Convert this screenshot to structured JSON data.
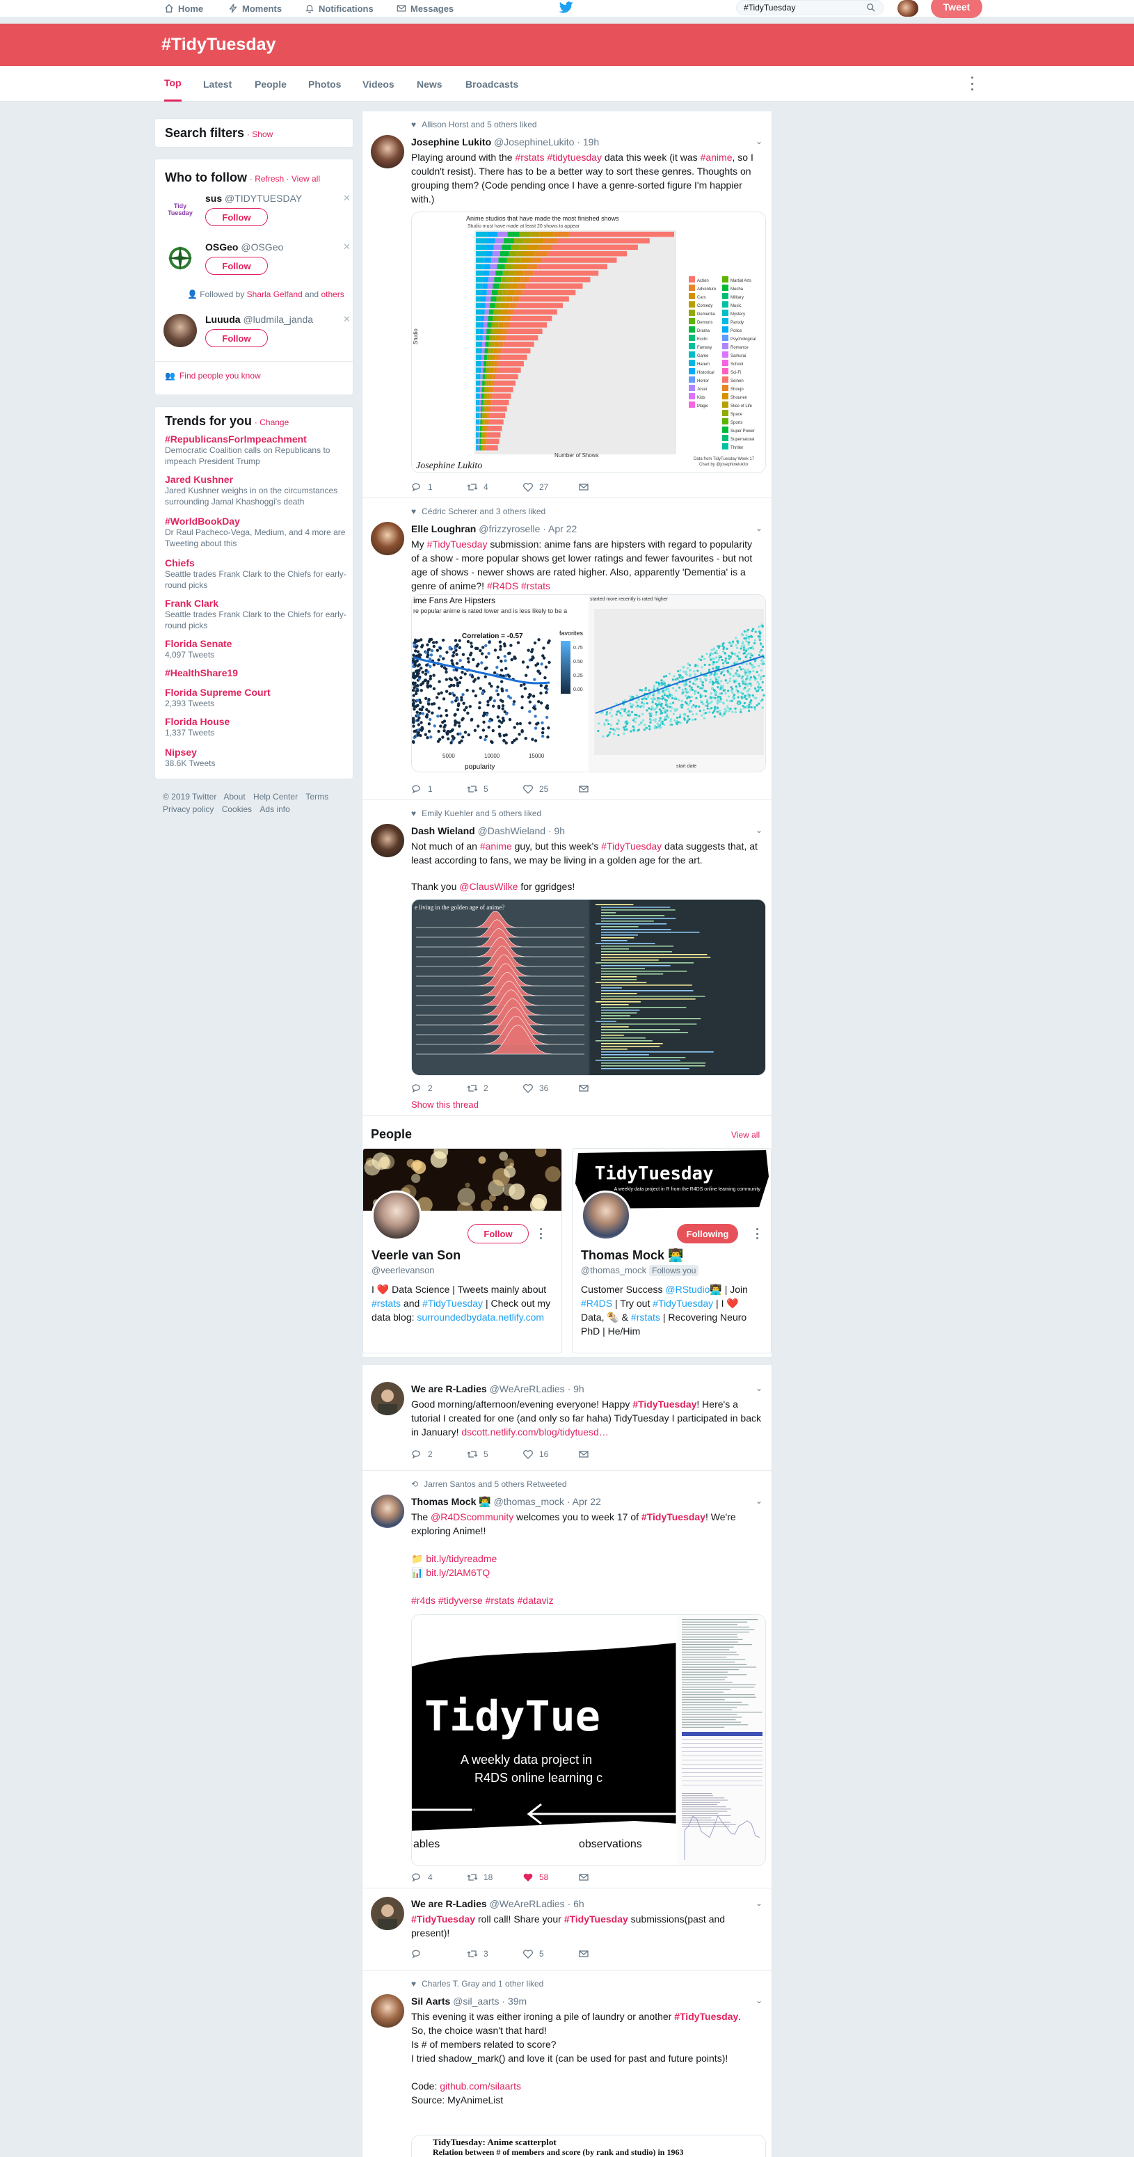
{
  "nav": {
    "home": "Home",
    "moments": "Moments",
    "notifications": "Notifications",
    "messages": "Messages",
    "search_value": "#TidyTuesday",
    "tweet": "Tweet"
  },
  "banner_title": "#TidyTuesday",
  "tabs": [
    "Top",
    "Latest",
    "People",
    "Photos",
    "Videos",
    "News",
    "Broadcasts"
  ],
  "search_filters": {
    "title": "Search filters",
    "show": "· Show"
  },
  "who_to_follow": {
    "title": "Who to follow",
    "refresh": "· Refresh · View all",
    "users": [
      {
        "name": "sus",
        "handle": "@TIDYTUESDAY",
        "follow": "Follow",
        "logo_text": "Tidy Tuesday"
      },
      {
        "name": "OSGeo",
        "handle": "@OSGeo",
        "follow": "Follow"
      },
      {
        "name": "Luuuda",
        "handle": "@ludmila_janda",
        "follow": "Follow"
      }
    ],
    "followed_by_prefix": "Followed by",
    "followed_by_name": "Sharla Gelfand",
    "followed_by_mid": "and",
    "followed_by_others": "others",
    "find_people": "Find people you know"
  },
  "trends": {
    "title": "Trends for you",
    "change": "· Change",
    "items": [
      {
        "name": "#RepublicansForImpeachment",
        "desc": "Democratic Coalition calls on Republicans to impeach President Trump"
      },
      {
        "name": "Jared Kushner",
        "desc": "Jared Kushner weighs in on the circumstances surrounding Jamal Khashoggi's death"
      },
      {
        "name": "#WorldBookDay",
        "desc": "Dr Raul Pacheco-Vega, Medium, and 4 more are Tweeting about this"
      },
      {
        "name": "Chiefs",
        "desc": "Seattle trades Frank Clark to the Chiefs for early-round picks"
      },
      {
        "name": "Frank Clark",
        "desc": "Seattle trades Frank Clark to the Chiefs for early-round picks"
      },
      {
        "name": "Florida Senate",
        "desc": "4,097 Tweets"
      },
      {
        "name": "#HealthShare19",
        "desc": ""
      },
      {
        "name": "Florida Supreme Court",
        "desc": "2,393 Tweets"
      },
      {
        "name": "Florida House",
        "desc": "1,337 Tweets"
      },
      {
        "name": "Nipsey",
        "desc": "38.6K Tweets"
      }
    ]
  },
  "footer": {
    "line1": [
      "© 2019 Twitter",
      "About",
      "Help Center",
      "Terms"
    ],
    "line2": [
      "Privacy policy",
      "Cookies",
      "Ads info"
    ]
  },
  "tweets": {
    "t1": {
      "context": "Allison Horst and 5 others liked",
      "name": "Josephine Lukito",
      "handle": "@JosephineLukito",
      "time": "· 19h",
      "text_a": "Playing around with the ",
      "tag1": "#rstats #tidytuesday",
      "text_b": " data this week (it was ",
      "tag2": "#anime",
      "text_c": ", so I couldn't resist). There has to be a better way to sort these genres. Thoughts on grouping them? (Code pending once I have a genre-sorted figure I'm happier with.)",
      "chart_title": "Anime studios that have made the most finished shows",
      "chart_subtitle": "Studio must have made at least 20 shows to appear",
      "chart_ylabel": "Studio",
      "chart_xlabel": "Number of Shows",
      "chart_caption_a": "Data from TidyTuesday Week 17",
      "chart_caption_b": "Chart by @josephinelukito",
      "signature": "Josephine Lukito",
      "legend_left": [
        "Action",
        "Adventure",
        "Cars",
        "Comedy",
        "Dementia",
        "Demons",
        "Drama",
        "Ecchi",
        "Fantasy",
        "Game",
        "Harem",
        "Historical",
        "Horror",
        "Josei",
        "Kids",
        "Magic"
      ],
      "legend_right": [
        "Martial Arts",
        "Mecha",
        "Military",
        "Music",
        "Mystery",
        "Parody",
        "Police",
        "Psychological",
        "Romance",
        "Samurai",
        "School",
        "Sci-Fi",
        "Seinen",
        "Shoujo",
        "Shounen",
        "Slice of Life",
        "Space",
        "Sports",
        "Super Power",
        "Supernatural",
        "Thriller"
      ],
      "replies": "1",
      "retweets": "4",
      "likes": "27"
    },
    "t2": {
      "context": "Cédric Scherer and 3 others liked",
      "name": "Elle Loughran",
      "handle": "@frizzyroselle",
      "time": "· Apr 22",
      "text_a": "My ",
      "tag1": "#TidyTuesday",
      "text_b": " submission: anime fans are hipsters with regard to popularity of a show - more popular shows get lower ratings and fewer favourites - but not age of shows - newer shows are rated higher. Also, apparently 'Dementia' is a genre of anime?! ",
      "tag2": "#R4DS #rstats",
      "img1_title": "ime Fans Are Hipsters",
      "img1_sub": "re popular anime is rated lower and is less likely to be a",
      "img1_corr": "Correlation = -0.57",
      "img1_xlabel": "popularity",
      "img1_ticks": [
        "5000",
        "10000",
        "15000"
      ],
      "img1_legend_title": "favorites",
      "img1_legend_ticks": [
        "0.75",
        "0.50",
        "0.25",
        "0.00"
      ],
      "img2_title": "started more recently is rated higher",
      "img2_xlabel": "start date",
      "replies": "1",
      "retweets": "5",
      "likes": "25"
    },
    "t3": {
      "context": "Emily Kuehler and 5 others liked",
      "name": "Dash Wieland",
      "handle": "@DashWieland",
      "time": "· 9h",
      "text_a": "Not much of an ",
      "tag1": "#anime",
      "text_b": " guy, but this week's ",
      "tag2": "#TidyTuesday",
      "text_c": " data suggests that, at least according to fans, we may be living in a golden age for the art.",
      "thanks_a": "Thank you ",
      "thanks_tag": "@ClausWilke",
      "thanks_b": " for ggridges!",
      "ridge_title": "e living in the golden age of anime?",
      "replies": "2",
      "retweets": "2",
      "likes": "36",
      "show_thread": "Show this thread"
    },
    "people": {
      "title": "People",
      "view_all": "View all",
      "p1": {
        "name": "Veerle van Son",
        "handle": "@veerlevanson",
        "follow": "Follow",
        "bio_a": "I ",
        "bio_b": " Data Science | Tweets mainly about ",
        "tag1": "#rstats",
        "bio_c": " and ",
        "tag2": "#TidyTuesday",
        "bio_d": " | Check out my data blog: ",
        "link": "surroundedbydata.netlify.com"
      },
      "p2": {
        "name": "Thomas Mock",
        "handle": "@thomas_mock",
        "follows_you": "Follows you",
        "following": "Following",
        "cover_title": "TidyTuesday",
        "cover_sub": "A weekly data project in R from the R4DS online learning community",
        "bio_a": "Customer Success ",
        "tag1": "@RStudio",
        "bio_b": " | Join ",
        "tag2": "#R4DS",
        "bio_c": " | Try out ",
        "tag3": "#TidyTuesday",
        "bio_d": " | I ",
        "bio_e": " Data, ",
        "bio_f": " & ",
        "tag4": "#rstats",
        "bio_g": " | Recovering Neuro PhD | He/Him"
      }
    },
    "t4": {
      "name": "We are R-Ladies",
      "handle": "@WeAreRLadies",
      "time": "· 9h",
      "text_a": "Good morning/afternoon/evening everyone! Happy ",
      "tag1": "#TidyTuesday",
      "text_b": "! Here's a tutorial I created for one (and only so far haha) TidyTuesday I participated in back in January! ",
      "link": "dscott.netlify.com/blog/tidytuesd…",
      "replies": "2",
      "retweets": "5",
      "likes": "16"
    },
    "t5": {
      "context": "Jarren Santos and 5 others Retweeted",
      "name": "Thomas Mock",
      "handle": "@thomas_mock",
      "time": "· Apr 22",
      "text_a": "The ",
      "tag1": "@R4DScommunity",
      "text_b": " welcomes you to week 17 of ",
      "tag2": "#TidyTuesday",
      "text_c": "!  We're exploring Anime!!",
      "link1": "bit.ly/tidyreadme",
      "link2": "bit.ly/2lAM6TQ",
      "tags": "#r4ds #tidyverse #rstats #dataviz",
      "img_title": "TidyTue",
      "img_sub_a": "A weekly data project in",
      "img_sub_b": "R4DS online learning c",
      "img_word_a": "ables",
      "img_word_b": "observations",
      "replies": "4",
      "retweets": "18",
      "likes": "58"
    },
    "t6": {
      "name": "We are R-Ladies",
      "handle": "@WeAreRLadies",
      "time": "· 6h",
      "tag1": "#TidyTuesday",
      "text_a": " roll call! Share your ",
      "tag2": "#TidyTuesday",
      "text_b": " submissions(past and present)!",
      "replies": "",
      "retweets": "3",
      "likes": "5"
    },
    "t7": {
      "context": "Charles T. Gray and 1 other liked",
      "name": "Sil Aarts",
      "handle": "@sil_aarts",
      "time": "· 39m",
      "line1_a": "This evening it was either ironing a pile of laundry or another ",
      "line1_tag": "#TidyTuesday",
      "line1_b": ".",
      "line2": "So, the choice wasn't that hard!",
      "line3": "Is # of members related to score?",
      "line4": "I tried shadow_mark() and love it (can be used for past and future points)!",
      "code_a": "Code: ",
      "code_link": "github.com/silaarts",
      "source": "Source: MyAnimeList",
      "img_title": "TidyTuesday: Anime scatterplot",
      "img_sub": "Relation between # of members and score (by rank and studio) in 1963"
    }
  },
  "colors": {
    "brand": "#e7525a",
    "accent": "#e0245e",
    "link": "#1da1f2"
  }
}
